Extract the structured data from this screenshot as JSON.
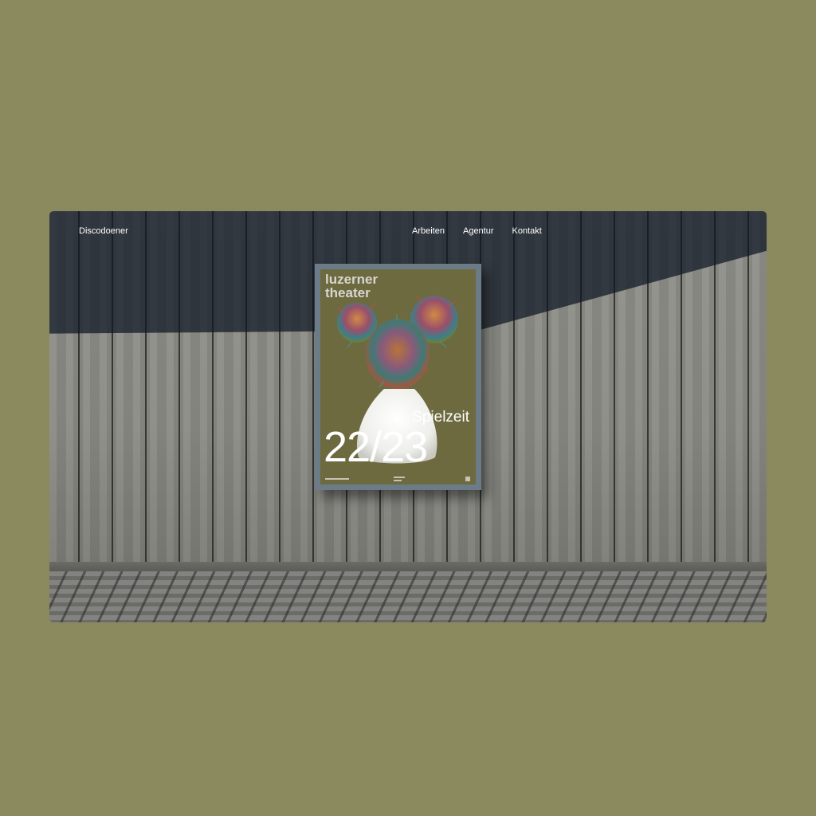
{
  "header": {
    "brand": "Discodoener",
    "nav": [
      "Arbeiten",
      "Agentur",
      "Kontakt"
    ]
  },
  "hero": {
    "poster": {
      "title": "luzerner\ntheater",
      "subtitle": "Spielzeit",
      "number": "22/23"
    }
  },
  "colors": {
    "page_background": "#8b8a5e",
    "poster_background": "#6e6a3f",
    "text_on_image": "#ffffff"
  }
}
